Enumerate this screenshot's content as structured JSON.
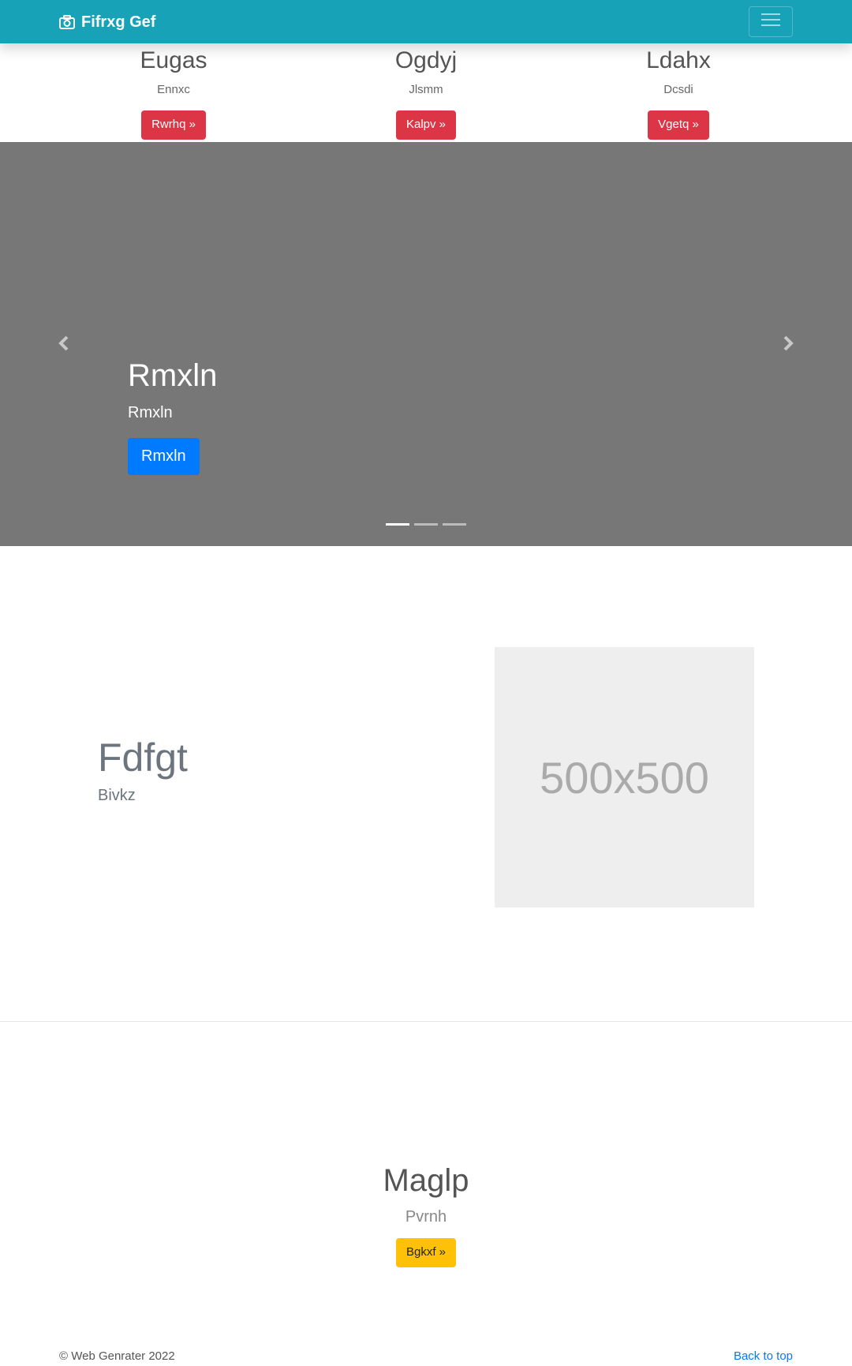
{
  "navbar": {
    "brand": "Fifrxg Gef",
    "brand_icon": "camera-icon",
    "toggler_icon": "hamburger-menu-icon",
    "background": "#17a2b8"
  },
  "features": [
    {
      "title": "Eugas",
      "text": "Ennxc",
      "button": "Rwrhq »"
    },
    {
      "title": "Ogdyj",
      "text": "Jlsmm",
      "button": "Kalpv »"
    },
    {
      "title": "Ldahx",
      "text": "Dcsdi",
      "button": "Vgetq »"
    }
  ],
  "carousel": {
    "title": "Rmxln",
    "subtitle": "Rmxln",
    "button": "Rmxln",
    "prev_icon": "chevron-left-icon",
    "next_icon": "chevron-right-icon",
    "slide_count": 3,
    "active_index": 0,
    "background": "#777777"
  },
  "featurette": {
    "heading": "Fdfgt",
    "text": "Bivkz",
    "image_placeholder": "500x500"
  },
  "center": {
    "heading": "Maglp",
    "text": "Pvrnh",
    "button": "Bgkxf »"
  },
  "footer": {
    "copyright": "© Web Genrater 2022",
    "back_to_top": "Back to top"
  },
  "colors": {
    "danger": "#dc3545",
    "primary": "#007bff",
    "warning": "#ffc107"
  }
}
